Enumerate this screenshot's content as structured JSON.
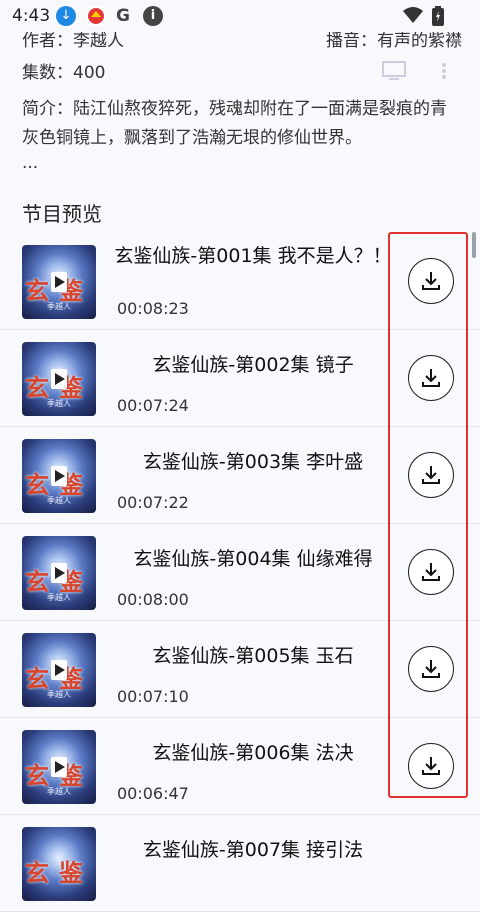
{
  "status_bar": {
    "time": "4:43",
    "download_glyph": "↓",
    "g_glyph": "G",
    "info_glyph": "i"
  },
  "meta": {
    "author": "作者：李越人",
    "narrator": "播音：有声的紫襟",
    "episodes": "集数：400",
    "intro": "简介：陆江仙熬夜猝死，残魂却附在了一面满是裂痕的青灰色铜镜上，飘落到了浩瀚无垠的修仙世界。",
    "ellipsis": "..."
  },
  "section_title": "节目预览",
  "cover_text": {
    "glyphs": "玄鉴",
    "sub": "季越人"
  },
  "episodes": [
    {
      "title": "玄鉴仙族-第001集 我不是人？！",
      "duration": "00:08:23"
    },
    {
      "title": "玄鉴仙族-第002集 镜子",
      "duration": "00:07:24"
    },
    {
      "title": "玄鉴仙族-第003集 李叶盛",
      "duration": "00:07:22"
    },
    {
      "title": "玄鉴仙族-第004集 仙缘难得",
      "duration": "00:08:00"
    },
    {
      "title": "玄鉴仙族-第005集 玉石",
      "duration": "00:07:10"
    },
    {
      "title": "玄鉴仙族-第006集 法决",
      "duration": "00:06:47"
    },
    {
      "title": "玄鉴仙族-第007集 接引法",
      "duration": ""
    }
  ],
  "icons": {
    "download": "download-icon",
    "play": "play-icon",
    "screen": "cast-screen-icon",
    "more": "more-dots-icon"
  },
  "colors": {
    "highlight": "#e0302f",
    "background": "#f7f9fd"
  }
}
